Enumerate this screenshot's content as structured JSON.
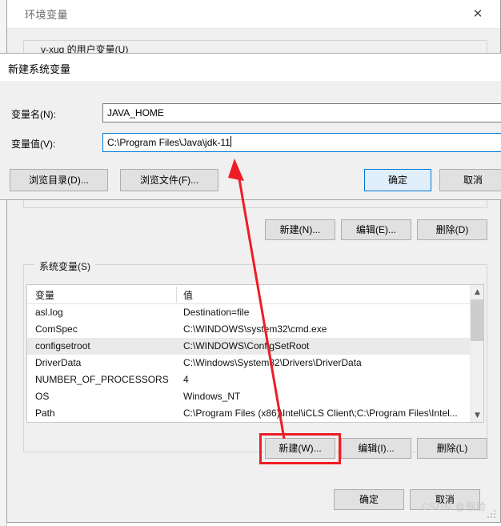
{
  "env_window": {
    "title": "环境变量",
    "close_icon": "close-icon",
    "user_group_label": "v-xug 的用户变量(U)",
    "user_buttons": [
      {
        "label": "新建(N)...",
        "name": "user-new-button"
      },
      {
        "label": "编辑(E)...",
        "name": "user-edit-button"
      },
      {
        "label": "删除(D)",
        "name": "user-delete-button"
      }
    ],
    "system_group_label": "系统变量(S)",
    "table": {
      "columns": [
        "变量",
        "值"
      ],
      "rows": [
        {
          "variable": "asl.log",
          "value": "Destination=file",
          "selected": false
        },
        {
          "variable": "ComSpec",
          "value": "C:\\WINDOWS\\system32\\cmd.exe",
          "selected": false
        },
        {
          "variable": "configsetroot",
          "value": "C:\\WINDOWS\\ConfigSetRoot",
          "selected": true
        },
        {
          "variable": "DriverData",
          "value": "C:\\Windows\\System32\\Drivers\\DriverData",
          "selected": false
        },
        {
          "variable": "NUMBER_OF_PROCESSORS",
          "value": "4",
          "selected": false
        },
        {
          "variable": "OS",
          "value": "Windows_NT",
          "selected": false
        },
        {
          "variable": "Path",
          "value": "C:\\Program Files (x86)\\Intel\\iCLS Client\\;C:\\Program Files\\Intel...",
          "selected": false
        }
      ],
      "scroll_up_icon": "chevron-up-icon",
      "scroll_down_icon": "chevron-down-icon"
    },
    "system_buttons": [
      {
        "label": "新建(W)...",
        "name": "system-new-button",
        "highlighted": true
      },
      {
        "label": "编辑(I)...",
        "name": "system-edit-button",
        "highlighted": false
      },
      {
        "label": "删除(L)",
        "name": "system-delete-button",
        "highlighted": false
      }
    ],
    "ok_label": "确定",
    "cancel_label": "取消"
  },
  "new_variable_dialog": {
    "title": "新建系统变量",
    "name_label": "变量名(N):",
    "name_value": "JAVA_HOME",
    "value_label": "变量值(V):",
    "value_value": "C:\\Program Files\\Java\\jdk-11",
    "browse_directory_label": "浏览目录(D)...",
    "browse_file_label": "浏览文件(F)...",
    "ok_label": "确定",
    "cancel_label": "取消"
  },
  "annotation": {
    "arrow_color": "#ee1c25",
    "highlight_color": "#ee1c25"
  },
  "watermark": "CSDN @假脸"
}
